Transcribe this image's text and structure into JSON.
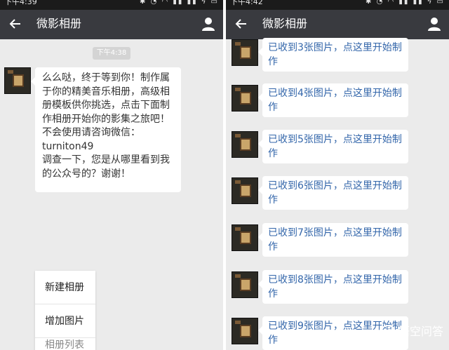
{
  "left": {
    "statusbar": {
      "time": "下午4:39",
      "icons": "✱ ◔ ◠ ▮▮ ▮▮ ϟ ▭"
    },
    "titlebar": {
      "title": "微影相册"
    },
    "timestamp": "下午4:38",
    "message": {
      "lines": [
        "么么哒，终于等到你！制作属",
        "于你的精美音乐相册，高级相",
        "册模板供你挑选，点击下面制",
        "作相册开始你的影集之旅吧！",
        "不会使用请咨询微信：",
        "turniton49",
        "调查一下，您是从哪里看到我",
        "的公众号的？谢谢！"
      ]
    },
    "menu": {
      "items": [
        "新建相册",
        "增加图片",
        "相册列表"
      ]
    }
  },
  "right": {
    "statusbar": {
      "time": "下午4:42",
      "icons": "✱ ◔ ◠ ▮▮ ▮▮ ϟ ▭"
    },
    "titlebar": {
      "title": "微影相册"
    },
    "messages": [
      {
        "line1": "已收到3张图片，点这里开始制",
        "line2": "作"
      },
      {
        "line1": "已收到4张图片，点这里开始制",
        "line2": "作"
      },
      {
        "line1": "已收到5张图片，点这里开始制",
        "line2": "作"
      },
      {
        "line1": "已收到6张图片，点这里开始制",
        "line2": "作"
      },
      {
        "line1": "已收到7张图片，点这里开始制",
        "line2": "作"
      },
      {
        "line1": "已收到8张图片，点这里开始制",
        "line2": "作"
      },
      {
        "line1": "已收到9张图片，点这里开始制",
        "line2": "作"
      }
    ]
  },
  "watermark": "悟空问答",
  "colors": {
    "titlebar": "#393a3f",
    "chat_bg": "#ebebeb",
    "link_text": "#3366aa"
  }
}
